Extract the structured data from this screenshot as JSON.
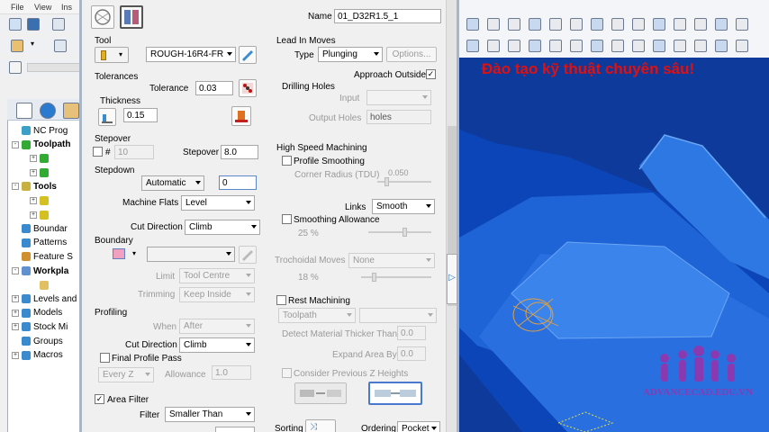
{
  "left_menu": [
    "File",
    "View",
    "Ins"
  ],
  "tree": [
    {
      "label": "NC Prog",
      "exp": "",
      "color": "#3aa0c8"
    },
    {
      "label": "Toolpath",
      "exp": "-",
      "color": "#33aa33",
      "bold": true
    },
    {
      "label": "",
      "exp": "+",
      "color": "#33aa33"
    },
    {
      "label": "",
      "exp": "+",
      "color": "#33aa33"
    },
    {
      "label": "Tools",
      "exp": "-",
      "color": "#c8b040",
      "bold": true
    },
    {
      "label": "",
      "exp": "+",
      "color": "#d4c020"
    },
    {
      "label": "",
      "exp": "+",
      "color": "#d4c020"
    },
    {
      "label": "Boundar",
      "exp": "",
      "color": "#3a8ad0"
    },
    {
      "label": "Patterns",
      "exp": "",
      "color": "#3a8ad0"
    },
    {
      "label": "Feature S",
      "exp": "",
      "color": "#d09030"
    },
    {
      "label": "Workpla",
      "exp": "-",
      "color": "#6090d0",
      "bold": true
    },
    {
      "label": "",
      "exp": "",
      "color": "#e0c060"
    },
    {
      "label": "Levels and",
      "exp": "+",
      "color": "#3a8ad0"
    },
    {
      "label": "Models",
      "exp": "+",
      "color": "#3a8ad0"
    },
    {
      "label": "Stock Mi",
      "exp": "+",
      "color": "#3a8ad0"
    },
    {
      "label": "Groups",
      "exp": "",
      "color": "#3a8ad0"
    },
    {
      "label": "Macros",
      "exp": "+",
      "color": "#3a8ad0"
    }
  ],
  "dialog": {
    "name_label": "Name",
    "name_value": "01_D32R1.5_1",
    "tool": {
      "label": "Tool",
      "value": "ROUGH-16R4-FR"
    },
    "tolerances": {
      "label": "Tolerances",
      "tol_label": "Tolerance",
      "tol_value": "0.03",
      "thick_label": "Thickness",
      "thick_value": "0.15"
    },
    "stepover": {
      "label": "Stepover",
      "hash": "#",
      "count": "10",
      "step_label": "Stepover",
      "step_value": "8.0"
    },
    "stepdown": {
      "label": "Stepdown",
      "mode": "Automatic",
      "value": "0"
    },
    "machine_flats": {
      "label": "Machine Flats",
      "value": "Level"
    },
    "cut_direction": {
      "label": "Cut Direction",
      "value": "Climb"
    },
    "boundary": {
      "label": "Boundary",
      "limit_label": "Limit",
      "limit_value": "Tool Centre",
      "trim_label": "Trimming",
      "trim_value": "Keep Inside"
    },
    "profiling": {
      "label": "Profiling",
      "when_label": "When",
      "when_value": "After",
      "cut_label": "Cut Direction",
      "cut_value": "Climb",
      "final_label": "Final Profile Pass",
      "everyz": "Every Z",
      "allow_label": "Allowance",
      "allow_value": "1.0"
    },
    "area_filter": {
      "label": "Area Filter",
      "filter_label": "Filter",
      "filter_value": "Smaller Than"
    },
    "lead": {
      "label": "Lead In Moves",
      "type_label": "Type",
      "type_value": "Plunging",
      "options": "Options...",
      "approach": "Approach Outside"
    },
    "drilling": {
      "label": "Drilling Holes",
      "input_label": "Input",
      "output_label": "Output Holes",
      "output_value": "holes"
    },
    "hsm": {
      "label": "High Speed Machining",
      "profile": "Profile Smoothing",
      "corner_label": "Corner Radius (TDU)",
      "corner_value": "0.050",
      "links_label": "Links",
      "links_value": "Smooth",
      "smooth_allow": "Smoothing Allowance",
      "pct25": "25 %"
    },
    "trochoidal": {
      "label": "Trochoidal Moves",
      "value": "None",
      "pct18": "18 %"
    },
    "rest": {
      "label": "Rest Machining",
      "toolpath": "Toolpath",
      "detect_label": "Detect Material Thicker Than",
      "detect_value": "0.0",
      "expand_label": "Expand Area By",
      "expand_value": "0.0",
      "consider": "Consider Previous Z Heights"
    },
    "sorting": {
      "label": "Sorting",
      "ordering_label": "Ordering",
      "ordering_value": "Pocket"
    }
  },
  "banner": "Đào tạo kỹ thuật chuyên sâu!",
  "watermark": "ADVANCECAD.EDU.VN"
}
